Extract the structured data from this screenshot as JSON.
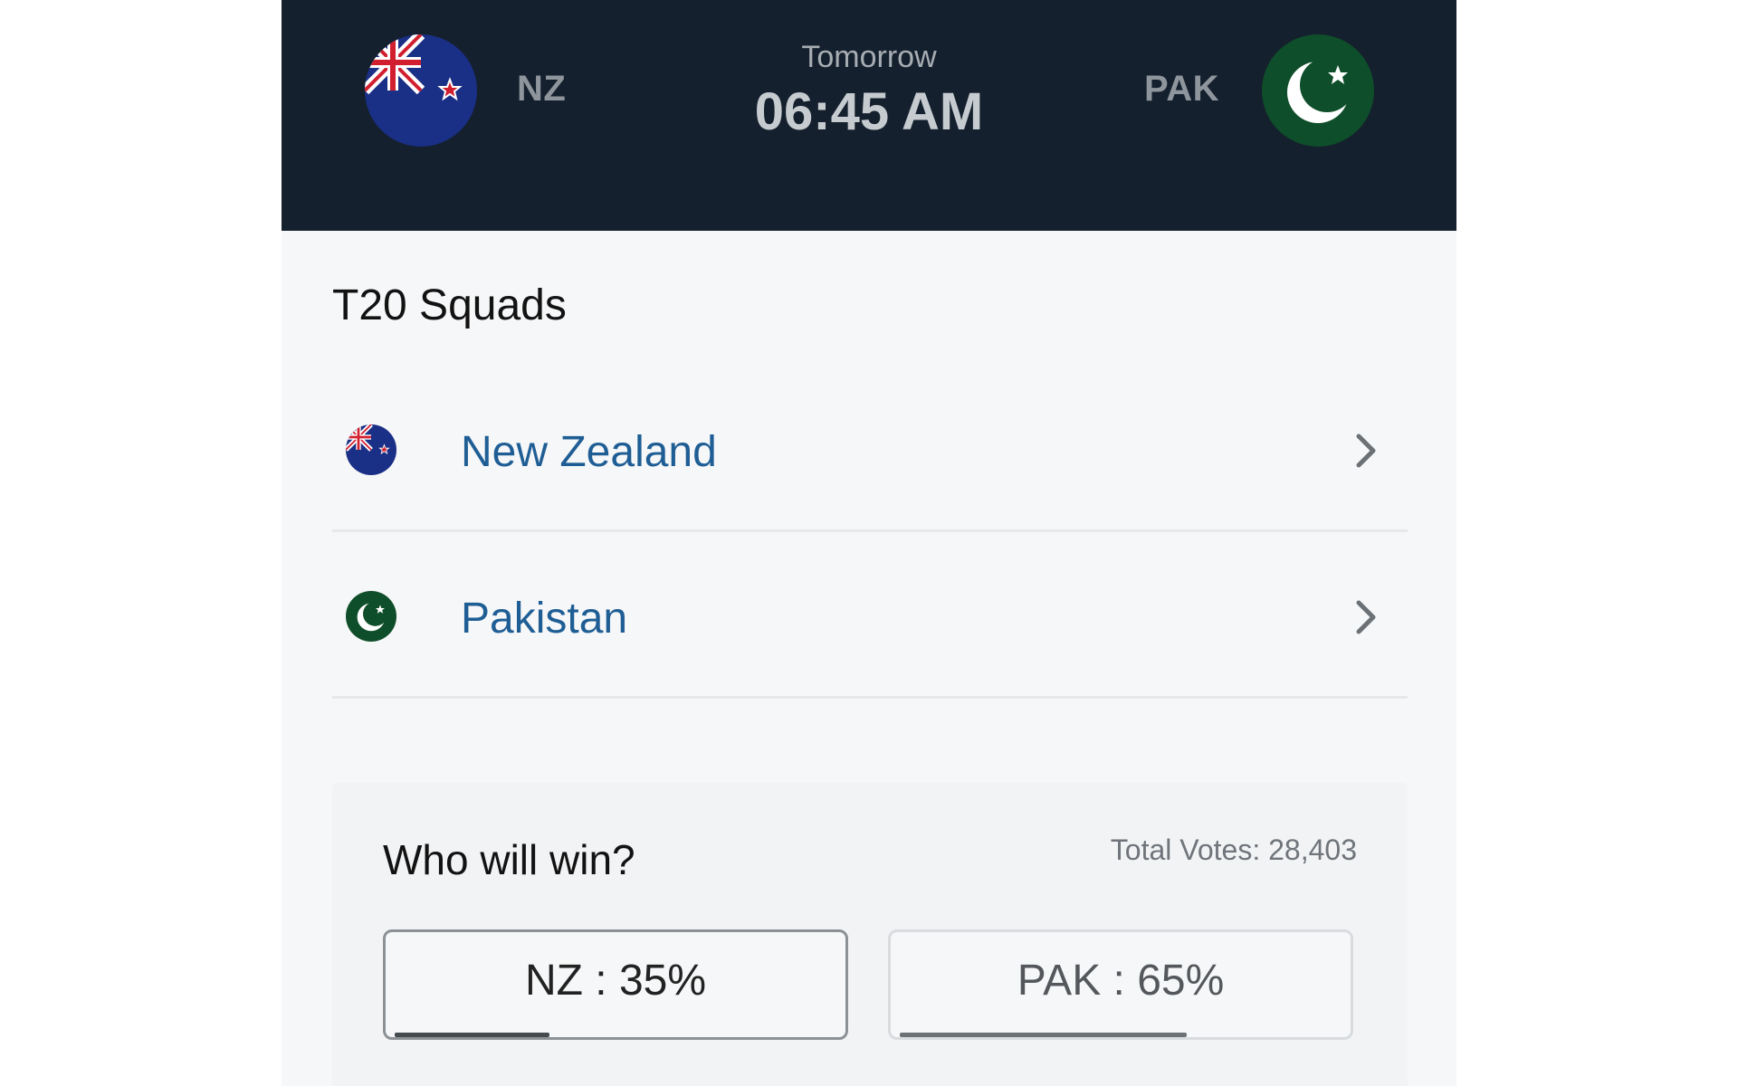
{
  "match": {
    "day": "Tomorrow",
    "time": "06:45 AM",
    "home": {
      "code": "NZ",
      "flag_icon": "new-zealand-flag-icon"
    },
    "away": {
      "code": "PAK",
      "flag_icon": "pakistan-flag-icon"
    }
  },
  "squads": {
    "title": "T20 Squads",
    "items": [
      {
        "name": "New Zealand",
        "flag_icon": "new-zealand-flag-icon",
        "chevron_icon": "chevron-right-icon"
      },
      {
        "name": "Pakistan",
        "flag_icon": "pakistan-flag-icon",
        "chevron_icon": "chevron-right-icon"
      }
    ]
  },
  "poll": {
    "title": "Who will win?",
    "total_votes": "Total Votes: 28,403",
    "options": [
      {
        "label": "NZ : 35%",
        "percent": 35
      },
      {
        "label": "PAK : 65%",
        "percent": 65
      }
    ]
  },
  "colors": {
    "header_bg": "#14202d",
    "link_blue": "#1f5e95",
    "nz_flag_blue": "#1a2f86",
    "pak_flag_green": "#0f4e2a"
  }
}
